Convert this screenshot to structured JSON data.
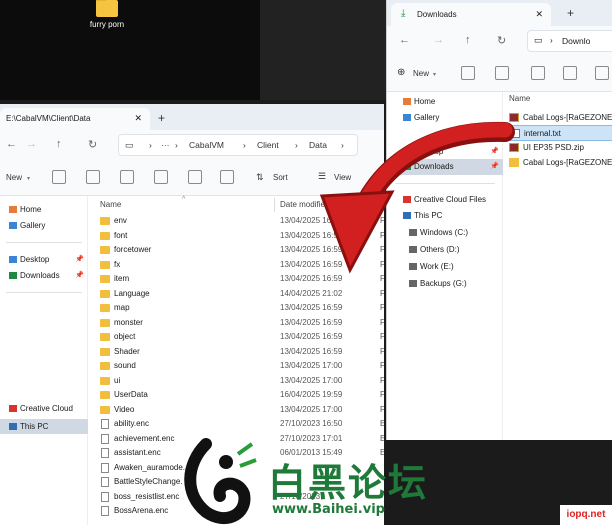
{
  "desktop": {
    "icon_label": "furry porn"
  },
  "main_window": {
    "tab_title": "E:\\CabalVM\\Client\\Data",
    "breadcrumb": [
      "CabalVM",
      "Client",
      "Data"
    ],
    "breadcrumb_more": "···",
    "toolbar": {
      "new": "New",
      "sort": "Sort",
      "view": "View"
    },
    "sidebar": [
      {
        "label": "Home"
      },
      {
        "label": "Gallery"
      },
      {
        "label": "Desktop"
      },
      {
        "label": "Downloads"
      },
      {
        "label": "Creative Cloud Files"
      },
      {
        "label": "This PC"
      }
    ],
    "columns": {
      "name": "Name",
      "date": "Date modified"
    },
    "files": [
      {
        "name": "env",
        "date": "13/04/2025 16:59",
        "type": "F",
        "kind": "folder"
      },
      {
        "name": "font",
        "date": "13/04/2025 16:59",
        "type": "F",
        "kind": "folder"
      },
      {
        "name": "forcetower",
        "date": "13/04/2025 16:59",
        "type": "F",
        "kind": "folder"
      },
      {
        "name": "fx",
        "date": "13/04/2025 16:59",
        "type": "F",
        "kind": "folder"
      },
      {
        "name": "item",
        "date": "13/04/2025 16:59",
        "type": "F",
        "kind": "folder"
      },
      {
        "name": "Language",
        "date": "14/04/2025 21:02",
        "type": "F",
        "kind": "folder"
      },
      {
        "name": "map",
        "date": "13/04/2025 16:59",
        "type": "F",
        "kind": "folder"
      },
      {
        "name": "monster",
        "date": "13/04/2025 16:59",
        "type": "F",
        "kind": "folder"
      },
      {
        "name": "object",
        "date": "13/04/2025 16:59",
        "type": "F",
        "kind": "folder"
      },
      {
        "name": "Shader",
        "date": "13/04/2025 16:59",
        "type": "F",
        "kind": "folder"
      },
      {
        "name": "sound",
        "date": "13/04/2025 17:00",
        "type": "F",
        "kind": "folder"
      },
      {
        "name": "ui",
        "date": "13/04/2025 17:00",
        "type": "F",
        "kind": "folder"
      },
      {
        "name": "UserData",
        "date": "16/04/2025 19:59",
        "type": "F",
        "kind": "folder"
      },
      {
        "name": "Video",
        "date": "13/04/2025 17:00",
        "type": "F",
        "kind": "folder"
      },
      {
        "name": "ability.enc",
        "date": "27/10/2023 16:50",
        "type": "E",
        "kind": "file"
      },
      {
        "name": "achievement.enc",
        "date": "27/10/2023 17:01",
        "type": "E",
        "kind": "file"
      },
      {
        "name": "assistant.enc",
        "date": "06/01/2013 15:49",
        "type": "E",
        "kind": "file"
      },
      {
        "name": "Awaken_auramode.",
        "date": "",
        "type": "",
        "kind": "file"
      },
      {
        "name": "BattleStyleChange.",
        "date": "",
        "type": "",
        "kind": "file"
      },
      {
        "name": "boss_resistlist.enc",
        "date": "27/10/2023",
        "type": "",
        "kind": "file"
      },
      {
        "name": "BossArena.enc",
        "date": "",
        "type": "",
        "kind": "file"
      }
    ]
  },
  "downloads_window": {
    "tab_title": "Downloads",
    "address": "Downlo",
    "toolbar": {
      "new": "New"
    },
    "sidebar": [
      {
        "label": "Home"
      },
      {
        "label": "Gallery"
      },
      {
        "label": "Desktop"
      },
      {
        "label": "Downloads"
      },
      {
        "label": "Creative Cloud Files"
      },
      {
        "label": "This PC"
      },
      {
        "label": "Windows (C:)"
      },
      {
        "label": "Others (D:)"
      },
      {
        "label": "Work (E:)"
      },
      {
        "label": "Backups (G:)"
      }
    ],
    "column_name": "Name",
    "files": [
      {
        "name": "Cabal Logs-[RaGEZONE]",
        "icon": "winrar"
      },
      {
        "name": "internal.txt",
        "icon": "text"
      },
      {
        "name": "UI EP35 PSD.zip",
        "icon": "winrar"
      },
      {
        "name": "Cabal Logs-[RaGEZONE]",
        "icon": "folder"
      }
    ]
  },
  "watermark": {
    "text": "白黑论坛",
    "url": "www.Baihei.vip"
  },
  "corner_badge": "iopq.net",
  "colors": {
    "accent_red": "#d21f1f",
    "folder_yellow": "#f1bf3d",
    "selection": "#cde3f7"
  }
}
